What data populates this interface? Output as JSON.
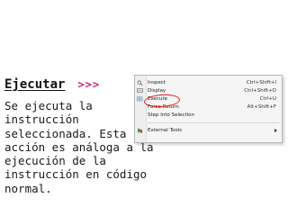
{
  "slide": {
    "title": "Ejecutar",
    "title_arrows": ">>>",
    "body_lines": [
      "Se ejecuta la",
      "instrucción",
      "seleccionada. Esta",
      "acción es análoga a la",
      "ejecución de la",
      "instrucción en código",
      "normal."
    ]
  },
  "context_menu": {
    "items": [
      {
        "label": "Inspect",
        "shortcut": "Ctrl+Shift+I",
        "icon": "inspect-icon"
      },
      {
        "label": "Display",
        "shortcut": "Ctrl+Shift+D",
        "icon": "display-icon"
      },
      {
        "label": "Execute",
        "shortcut": "Ctrl+U",
        "icon": "execute-icon"
      },
      {
        "label": "Force Return",
        "shortcut": "Alt+Shift+F",
        "icon": ""
      },
      {
        "label": "Step Into Selection",
        "shortcut": "",
        "icon": ""
      },
      {
        "label": "External Tools",
        "shortcut": "",
        "icon": "external-tools-icon"
      }
    ],
    "highlighted_item": "Execute"
  },
  "colors": {
    "arrows": "#c4217b",
    "highlight_oval": "#e0201a"
  }
}
